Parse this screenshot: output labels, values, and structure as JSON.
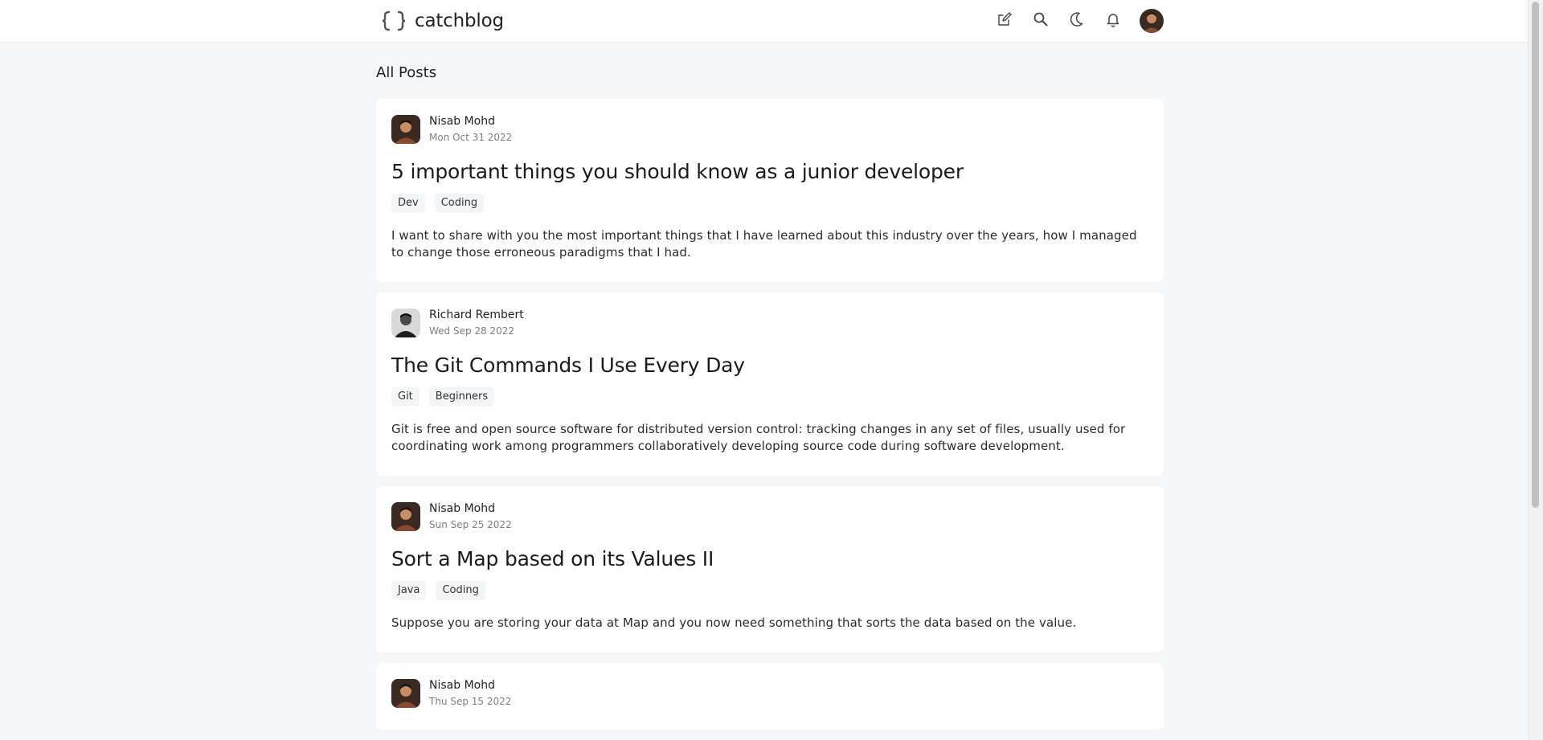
{
  "header": {
    "brand": "catchblog",
    "icons": [
      "edit-icon",
      "search-icon",
      "moon-icon",
      "bell-icon"
    ]
  },
  "page": {
    "section_title": "All Posts"
  },
  "posts": [
    {
      "author": "Nisab Mohd",
      "date": "Mon Oct 31 2022",
      "title": "5 important things you should know as a junior developer",
      "tags": [
        "Dev",
        "Coding"
      ],
      "excerpt": "I want to share with you the most important things that I have learned about this industry over the years, how I managed to change those erroneous paradigms that I had."
    },
    {
      "author": "Richard Rembert",
      "date": "Wed Sep 28 2022",
      "title": "The Git Commands I Use Every Day",
      "tags": [
        "Git",
        "Beginners"
      ],
      "excerpt": "Git is free and open source software for distributed version control: tracking changes in any set of files, usually used for coordinating work among programmers collaboratively developing source code during software development."
    },
    {
      "author": "Nisab Mohd",
      "date": "Sun Sep 25 2022",
      "title": "Sort a Map based on its Values II",
      "tags": [
        "Java",
        "Coding"
      ],
      "excerpt": "Suppose you are storing your data at Map and you now need something that sorts the data based on the value."
    },
    {
      "author": "Nisab Mohd",
      "date": "Thu Sep 15 2022",
      "title": "",
      "tags": [],
      "excerpt": ""
    }
  ],
  "colors": {
    "background": "#f5f6f8",
    "card": "#ffffff",
    "tag_bg": "#f4f5f7",
    "text": "#1b1b1b",
    "muted": "#7d7d7d"
  }
}
